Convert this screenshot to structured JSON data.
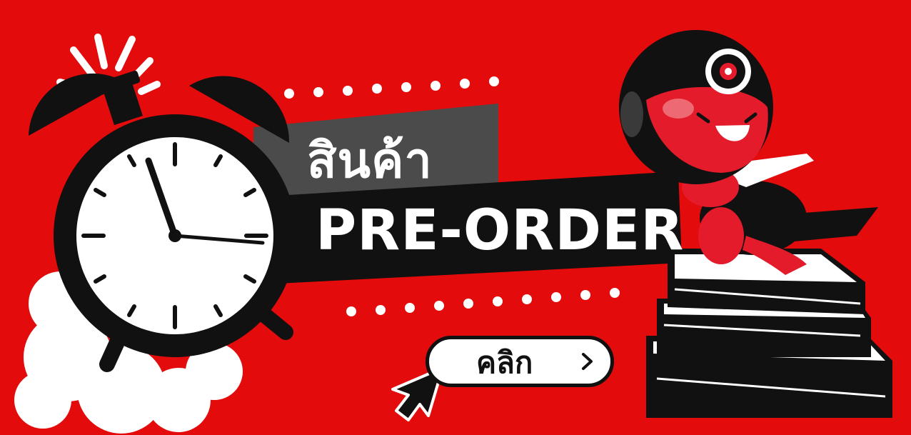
{
  "banner": {
    "title_thai": "สินค้า",
    "title_main": "PRE-ORDER",
    "cta_label": "คลิก"
  },
  "icons": [
    "alarm-clock-icon",
    "cursor-arrow-icon",
    "chevron-right-icon",
    "mascot-character",
    "book-stack"
  ],
  "colors": {
    "background": "#e30b0b",
    "dark": "#111111",
    "ribbon_gray": "#4b4b4b",
    "white": "#ffffff"
  }
}
